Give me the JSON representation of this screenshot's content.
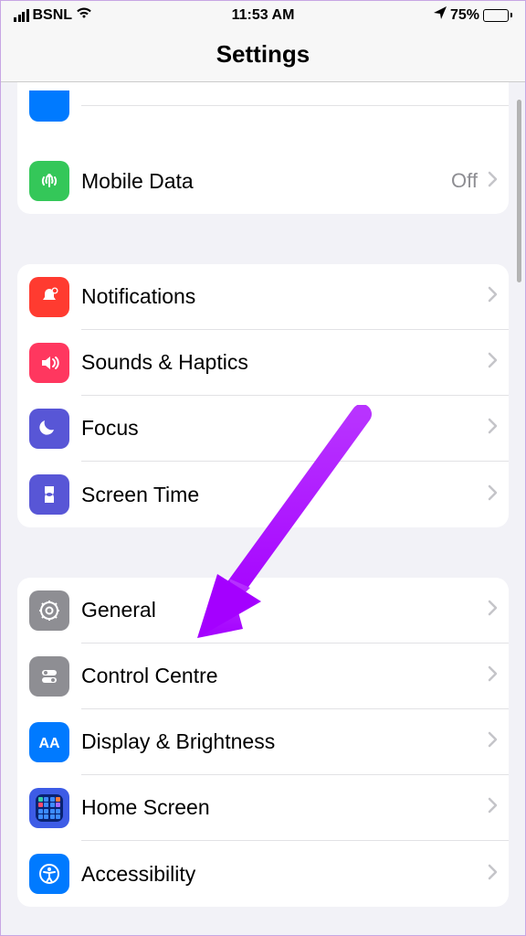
{
  "status": {
    "carrier": "BSNL",
    "time": "11:53 AM",
    "battery_pct": "75%"
  },
  "header": {
    "title": "Settings"
  },
  "groups": [
    {
      "rows": [
        {
          "icon": "top-partial",
          "label": "",
          "value": ""
        },
        {
          "icon": "mobile-data",
          "label": "Mobile Data",
          "value": "Off"
        }
      ]
    },
    {
      "rows": [
        {
          "icon": "notifications",
          "label": "Notifications",
          "value": ""
        },
        {
          "icon": "sounds",
          "label": "Sounds & Haptics",
          "value": ""
        },
        {
          "icon": "focus",
          "label": "Focus",
          "value": ""
        },
        {
          "icon": "screentime",
          "label": "Screen Time",
          "value": ""
        }
      ]
    },
    {
      "rows": [
        {
          "icon": "general",
          "label": "General",
          "value": ""
        },
        {
          "icon": "controlcentre",
          "label": "Control Centre",
          "value": ""
        },
        {
          "icon": "display",
          "label": "Display & Brightness",
          "value": ""
        },
        {
          "icon": "homescreen",
          "label": "Home Screen",
          "value": ""
        },
        {
          "icon": "accessibility",
          "label": "Accessibility",
          "value": ""
        }
      ]
    }
  ]
}
